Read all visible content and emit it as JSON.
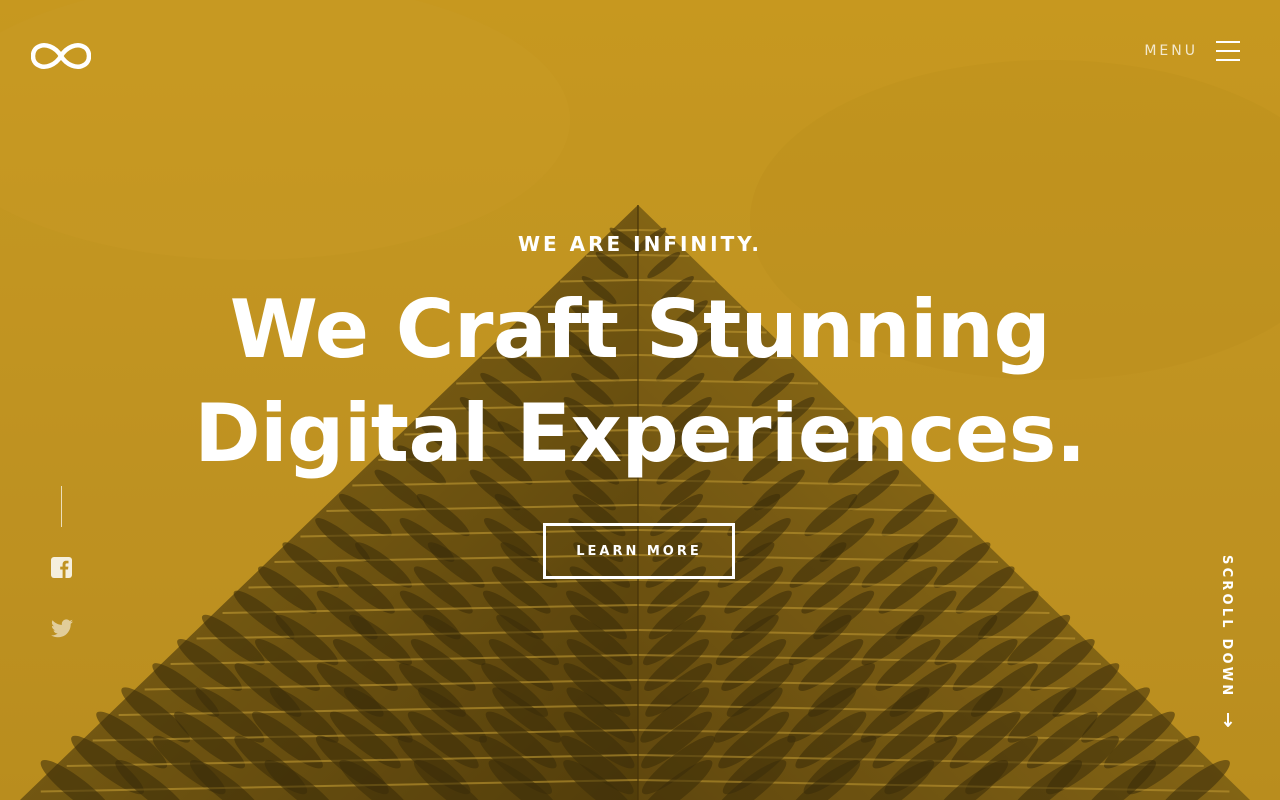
{
  "header": {
    "logo_icon": "infinity-logo-icon",
    "menu_label": "MENU",
    "menu_icon": "hamburger-icon"
  },
  "hero": {
    "eyebrow": "WE ARE INFINITY.",
    "headline_line1": "We Craft Stunning",
    "headline_line2": "Digital Experiences.",
    "cta_label": "LEARN MORE",
    "background_color": "#c4981f"
  },
  "social": {
    "items": [
      {
        "icon": "facebook-icon"
      },
      {
        "icon": "twitter-icon"
      }
    ]
  },
  "scroll": {
    "label": "SCROLL DOWN",
    "icon": "arrow-down-icon"
  }
}
